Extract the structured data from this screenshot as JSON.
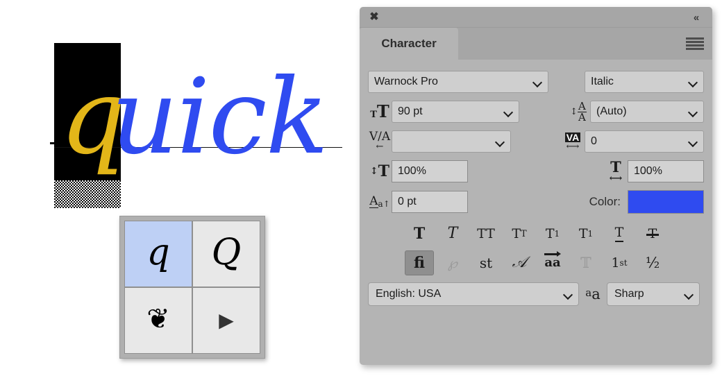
{
  "canvas": {
    "text_selected_glyph": "q",
    "text_rest": "uick",
    "selected_glyph_color": "#e3b619",
    "text_color": "#2f4bf0",
    "selection_block_color": "#000000"
  },
  "glyph_popup": {
    "cells": [
      {
        "name": "glyph-alt-q",
        "glyph": "q",
        "kind": "serif",
        "selected": true
      },
      {
        "name": "glyph-alt-Q",
        "glyph": "Q",
        "kind": "serif",
        "selected": false
      },
      {
        "name": "glyph-alt-ornament",
        "glyph": "❦",
        "kind": "ornament",
        "selected": false
      },
      {
        "name": "glyph-more-arrow",
        "glyph": "▶",
        "kind": "triangle",
        "selected": false
      }
    ],
    "selected_background": "#bed0f5"
  },
  "panel": {
    "title_tab": "Character",
    "close_icon": "close-icon",
    "collapse_icon": "double-chevron-left-icon",
    "menu_icon": "panel-menu-icon",
    "fields": {
      "font_family": {
        "label": "font-family",
        "value": "Warnock Pro"
      },
      "font_style": {
        "label": "font-style",
        "value": "Italic"
      },
      "font_size": {
        "label": "font-size",
        "value": "90 pt",
        "icon": "font-size-icon"
      },
      "leading": {
        "label": "leading",
        "value": "(Auto)",
        "icon": "leading-icon"
      },
      "kerning": {
        "label": "kerning",
        "value": "",
        "icon": "kerning-icon"
      },
      "tracking": {
        "label": "tracking",
        "value": "0",
        "icon": "tracking-icon"
      },
      "vertical_scale": {
        "label": "vertical-scale",
        "value": "100%",
        "icon": "vertical-scale-icon"
      },
      "horizontal_scale": {
        "label": "horizontal-scale",
        "value": "100%",
        "icon": "horizontal-scale-icon"
      },
      "baseline_shift": {
        "label": "baseline-shift",
        "value": "0 pt",
        "icon": "baseline-shift-icon"
      },
      "color": {
        "label": "Color:",
        "value": "#2f4bf0"
      }
    },
    "style_row_1": [
      {
        "name": "faux-bold-button",
        "glyph": "T",
        "variant": "bold",
        "active": false,
        "dim": false
      },
      {
        "name": "faux-italic-button",
        "glyph": "T",
        "variant": "italic",
        "active": false,
        "dim": false
      },
      {
        "name": "all-caps-button",
        "glyph": "TT",
        "variant": "caps",
        "active": false,
        "dim": false
      },
      {
        "name": "small-caps-button",
        "glyph": "T",
        "variant": "smallcaps",
        "active": false,
        "dim": false
      },
      {
        "name": "superscript-button",
        "glyph": "T",
        "variant": "super",
        "active": false,
        "dim": false
      },
      {
        "name": "subscript-button",
        "glyph": "T",
        "variant": "sub",
        "active": false,
        "dim": false
      },
      {
        "name": "underline-button",
        "glyph": "T",
        "variant": "underline",
        "active": false,
        "dim": false
      },
      {
        "name": "strikethrough-button",
        "glyph": "T",
        "variant": "strike",
        "active": false,
        "dim": false
      }
    ],
    "style_row_2": [
      {
        "name": "standard-ligatures-button",
        "glyph": "fi",
        "variant": "plain",
        "active": true,
        "dim": false
      },
      {
        "name": "fractional-widths-button",
        "glyph": "℘",
        "variant": "script",
        "active": false,
        "dim": true
      },
      {
        "name": "discretionary-ligatures-button",
        "glyph": "st",
        "variant": "plain",
        "active": false,
        "dim": false
      },
      {
        "name": "swash-button",
        "glyph": "𝒜",
        "variant": "plain",
        "active": false,
        "dim": false
      },
      {
        "name": "contextual-alternates-button",
        "glyph": "aa",
        "variant": "arrowtop",
        "active": false,
        "dim": false
      },
      {
        "name": "titling-alternates-button",
        "glyph": "𝕋",
        "variant": "plain",
        "active": false,
        "dim": true
      },
      {
        "name": "ordinals-button",
        "glyph": "1",
        "variant": "ordinal",
        "active": false,
        "dim": false
      },
      {
        "name": "fractions-button",
        "glyph": "½",
        "variant": "plain",
        "active": false,
        "dim": false
      }
    ],
    "ordinal_suffix": "st",
    "bottom": {
      "language": "English: USA",
      "antialias_icon": "antialias-icon",
      "antialias": "Sharp"
    }
  }
}
